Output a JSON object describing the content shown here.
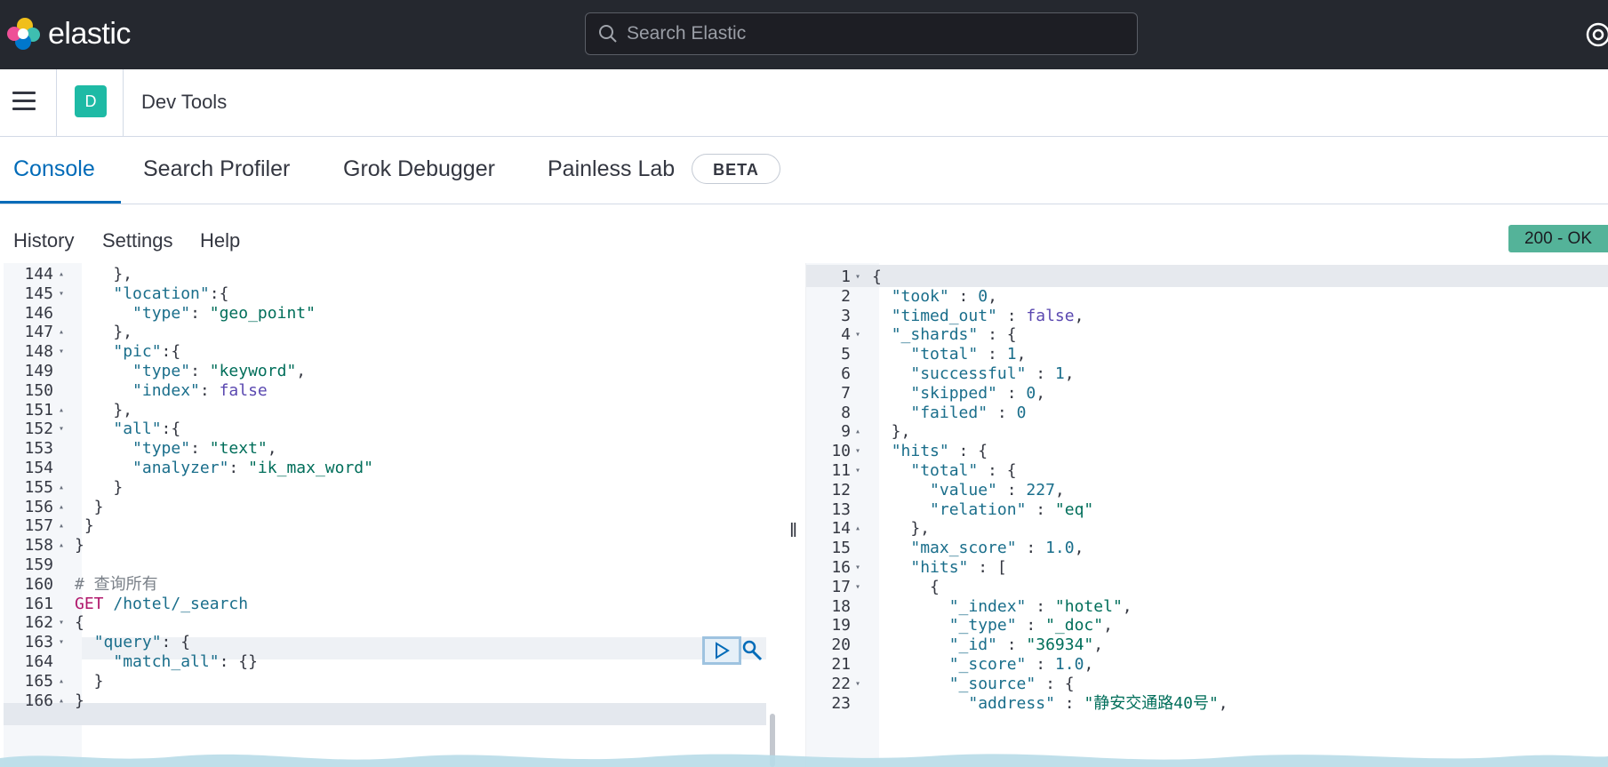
{
  "header": {
    "brand": "elastic",
    "search_placeholder": "Search Elastic",
    "icons": [
      "elastic-logo",
      "search-icon",
      "help-icon"
    ]
  },
  "breadcrumb": {
    "space_initial": "D",
    "title": "Dev Tools"
  },
  "tabs": [
    {
      "label": "Console",
      "active": true
    },
    {
      "label": "Search Profiler",
      "active": false
    },
    {
      "label": "Grok Debugger",
      "active": false
    },
    {
      "label": "Painless Lab",
      "active": false,
      "badge": "BETA"
    }
  ],
  "console_menu": {
    "items": [
      "History",
      "Settings",
      "Help"
    ],
    "status": "200 - OK"
  },
  "request_editor": {
    "lines": [
      {
        "n": "144",
        "f": "▴",
        "t": "    },"
      },
      {
        "n": "145",
        "f": "▾",
        "t": "    \"location\":{"
      },
      {
        "n": "146",
        "f": "",
        "t": "      \"type\": \"geo_point\""
      },
      {
        "n": "147",
        "f": "▴",
        "t": "    },"
      },
      {
        "n": "148",
        "f": "▾",
        "t": "    \"pic\":{"
      },
      {
        "n": "149",
        "f": "",
        "t": "      \"type\": \"keyword\","
      },
      {
        "n": "150",
        "f": "",
        "t": "      \"index\": false"
      },
      {
        "n": "151",
        "f": "▴",
        "t": "    },"
      },
      {
        "n": "152",
        "f": "▾",
        "t": "    \"all\":{"
      },
      {
        "n": "153",
        "f": "",
        "t": "      \"type\": \"text\","
      },
      {
        "n": "154",
        "f": "",
        "t": "      \"analyzer\": \"ik_max_word\""
      },
      {
        "n": "155",
        "f": "▴",
        "t": "    }"
      },
      {
        "n": "156",
        "f": "▴",
        "t": "  }"
      },
      {
        "n": "157",
        "f": "▴",
        "t": " }"
      },
      {
        "n": "158",
        "f": "▴",
        "t": "}"
      },
      {
        "n": "159",
        "f": "",
        "t": ""
      },
      {
        "n": "160",
        "f": "",
        "t": "# 查询所有"
      },
      {
        "n": "161",
        "f": "",
        "t": "GET /hotel/_search"
      },
      {
        "n": "162",
        "f": "▾",
        "t": "{"
      },
      {
        "n": "163",
        "f": "▾",
        "t": "  \"query\": {"
      },
      {
        "n": "164",
        "f": "",
        "t": "    \"match_all\": {}"
      },
      {
        "n": "165",
        "f": "▴",
        "t": "  }"
      },
      {
        "n": "166",
        "f": "▴",
        "t": "}"
      }
    ]
  },
  "response_editor": {
    "lines": [
      {
        "n": "1",
        "f": "▾",
        "t": "{"
      },
      {
        "n": "2",
        "f": "",
        "t": "  \"took\" : 0,"
      },
      {
        "n": "3",
        "f": "",
        "t": "  \"timed_out\" : false,"
      },
      {
        "n": "4",
        "f": "▾",
        "t": "  \"_shards\" : {"
      },
      {
        "n": "5",
        "f": "",
        "t": "    \"total\" : 1,"
      },
      {
        "n": "6",
        "f": "",
        "t": "    \"successful\" : 1,"
      },
      {
        "n": "7",
        "f": "",
        "t": "    \"skipped\" : 0,"
      },
      {
        "n": "8",
        "f": "",
        "t": "    \"failed\" : 0"
      },
      {
        "n": "9",
        "f": "▴",
        "t": "  },"
      },
      {
        "n": "10",
        "f": "▾",
        "t": "  \"hits\" : {"
      },
      {
        "n": "11",
        "f": "▾",
        "t": "    \"total\" : {"
      },
      {
        "n": "12",
        "f": "",
        "t": "      \"value\" : 227,"
      },
      {
        "n": "13",
        "f": "",
        "t": "      \"relation\" : \"eq\""
      },
      {
        "n": "14",
        "f": "▴",
        "t": "    },"
      },
      {
        "n": "15",
        "f": "",
        "t": "    \"max_score\" : 1.0,"
      },
      {
        "n": "16",
        "f": "▾",
        "t": "    \"hits\" : ["
      },
      {
        "n": "17",
        "f": "▾",
        "t": "      {"
      },
      {
        "n": "18",
        "f": "",
        "t": "        \"_index\" : \"hotel\","
      },
      {
        "n": "19",
        "f": "",
        "t": "        \"_type\" : \"_doc\","
      },
      {
        "n": "20",
        "f": "",
        "t": "        \"_id\" : \"36934\","
      },
      {
        "n": "21",
        "f": "",
        "t": "        \"_score\" : 1.0,"
      },
      {
        "n": "22",
        "f": "▾",
        "t": "        \"_source\" : {"
      },
      {
        "n": "23",
        "f": "",
        "t": "          \"address\" : \"静安交通路40号\","
      }
    ]
  }
}
